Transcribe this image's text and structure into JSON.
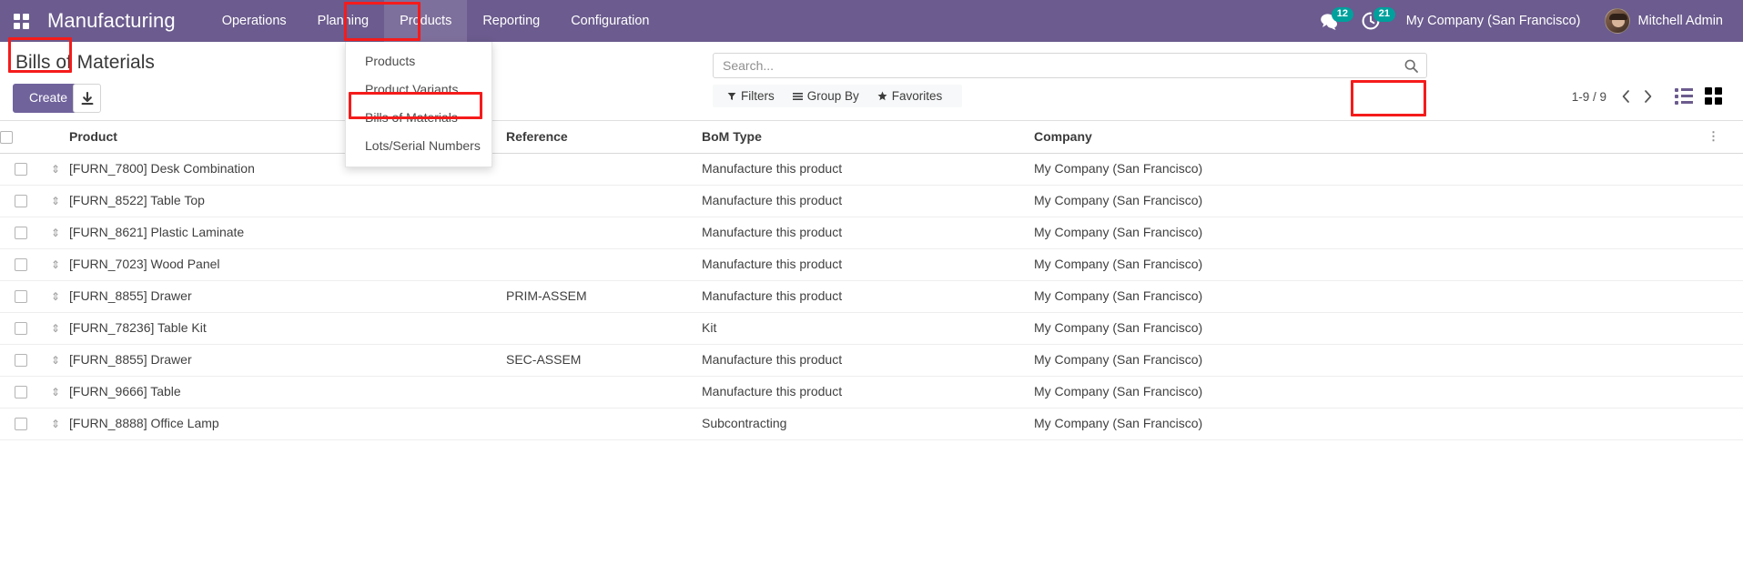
{
  "navbar": {
    "apps_icon": "apps-grid-icon",
    "brand": "Manufacturing",
    "menu_items": [
      {
        "label": "Operations",
        "active": false
      },
      {
        "label": "Planning",
        "active": false
      },
      {
        "label": "Products",
        "active": true
      },
      {
        "label": "Reporting",
        "active": false
      },
      {
        "label": "Configuration",
        "active": false
      }
    ],
    "messages_icon": "chat-bubble-icon",
    "messages_count": "12",
    "activities_icon": "clock-activity-icon",
    "activities_count": "21",
    "company": "My Company (San Francisco)",
    "user_name": "Mitchell Admin",
    "avatar_icon": "user-avatar",
    "brand_color": "#6b5b8e",
    "badge_color": "#00a09d"
  },
  "dropdown": {
    "open_for": "Products",
    "items": [
      {
        "label": "Products"
      },
      {
        "label": "Product Variants"
      },
      {
        "label": "Bills of Materials"
      },
      {
        "label": "Lots/Serial Numbers"
      }
    ]
  },
  "control_panel": {
    "title": "Bills of Materials",
    "create_label": "Create",
    "import_icon": "import-download-icon",
    "search": {
      "placeholder": "Search...",
      "value": "",
      "icon": "search-icon"
    },
    "filters": [
      {
        "label": "Filters",
        "icon": "filter-funnel-icon"
      },
      {
        "label": "Group By",
        "icon": "group-by-bars-icon"
      },
      {
        "label": "Favorites",
        "icon": "star-icon"
      }
    ],
    "pager": {
      "range": "1-9 / 9",
      "prev_icon": "chevron-left-icon",
      "next_icon": "chevron-right-icon"
    },
    "views": [
      {
        "name": "list",
        "icon": "list-view-icon",
        "active": true
      },
      {
        "name": "kanban",
        "icon": "kanban-view-icon",
        "active": false
      }
    ]
  },
  "table": {
    "columns": [
      "Product",
      "Reference",
      "BoM Type",
      "Company"
    ],
    "optional_columns_icon": "column-options-icon",
    "rows": [
      {
        "product": "[FURN_7800] Desk Combination",
        "reference": "",
        "bom_type": "Manufacture this product",
        "company": "My Company (San Francisco)"
      },
      {
        "product": "[FURN_8522] Table Top",
        "reference": "",
        "bom_type": "Manufacture this product",
        "company": "My Company (San Francisco)"
      },
      {
        "product": "[FURN_8621] Plastic Laminate",
        "reference": "",
        "bom_type": "Manufacture this product",
        "company": "My Company (San Francisco)"
      },
      {
        "product": "[FURN_7023] Wood Panel",
        "reference": "",
        "bom_type": "Manufacture this product",
        "company": "My Company (San Francisco)"
      },
      {
        "product": "[FURN_8855] Drawer",
        "reference": "PRIM-ASSEM",
        "bom_type": "Manufacture this product",
        "company": "My Company (San Francisco)"
      },
      {
        "product": "[FURN_78236] Table Kit",
        "reference": "",
        "bom_type": "Kit",
        "company": "My Company (San Francisco)"
      },
      {
        "product": "[FURN_8855] Drawer",
        "reference": "SEC-ASSEM",
        "bom_type": "Manufacture this product",
        "company": "My Company (San Francisco)"
      },
      {
        "product": "[FURN_9666] Table",
        "reference": "",
        "bom_type": "Manufacture this product",
        "company": "My Company (San Francisco)"
      },
      {
        "product": "[FURN_8888] Office Lamp",
        "reference": "",
        "bom_type": "Subcontracting",
        "company": "My Company (San Francisco)"
      }
    ]
  },
  "annotations": {
    "color": "#f51b1b",
    "boxes": [
      {
        "name": "products-menu-highlight"
      },
      {
        "name": "bills-of-materials-item-highlight"
      },
      {
        "name": "create-button-highlight"
      },
      {
        "name": "view-switcher-highlight"
      }
    ]
  }
}
